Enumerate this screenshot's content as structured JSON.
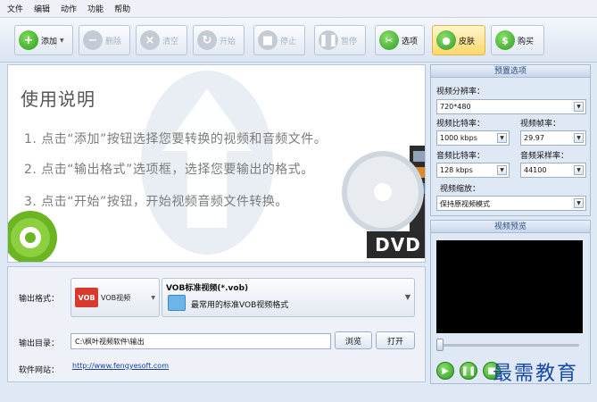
{
  "menu": {
    "items": [
      "文件",
      "编辑",
      "动作",
      "功能",
      "帮助"
    ]
  },
  "toolbar": {
    "add": "添加",
    "remove": "删除",
    "clear": "清空",
    "start": "开始",
    "stop": "停止",
    "pause": "暂停",
    "options": "选项",
    "skin": "皮肤",
    "buy": "购买"
  },
  "instructions": {
    "title": "使用说明",
    "step1": "1. 点击“添加”按钮选择您要转换的视频和音频文件。",
    "step2": "2. 点击“输出格式”选项框，选择您要输出的格式。",
    "step3": "3. 点击“开始”按钮，开始视频音频文件转换。",
    "dvd": "DVD"
  },
  "output": {
    "format_label": "输出格式：",
    "format_button": "VOB视频",
    "format_badge": "VOB",
    "format_title": "VOB标准视频(*.vob)",
    "format_desc": "最常用的标准VOB视频格式",
    "dir_label": "输出目录：",
    "dir_value": "C:\\枫叶视频软件\\输出",
    "browse": "浏览",
    "open": "打开",
    "site_label": "软件网站：",
    "site_url": "http://www.fengyesoft.com"
  },
  "presets": {
    "header": "预置选项",
    "resolution_label": "视频分辨率：",
    "resolution": "720*480",
    "vbitrate_label": "视频比特率：",
    "vbitrate": "1000 kbps",
    "framerate_label": "视频帧率：",
    "framerate": "29.97",
    "abitrate_label": "音频比特率：",
    "abitrate": "128 kbps",
    "samplerate_label": "音频采样率：",
    "samplerate": "44100",
    "scale_label": "视频缩放：",
    "scale": "保持原视频模式"
  },
  "preview": {
    "header": "视频预览",
    "position": 0
  },
  "watermark": "最需教育"
}
